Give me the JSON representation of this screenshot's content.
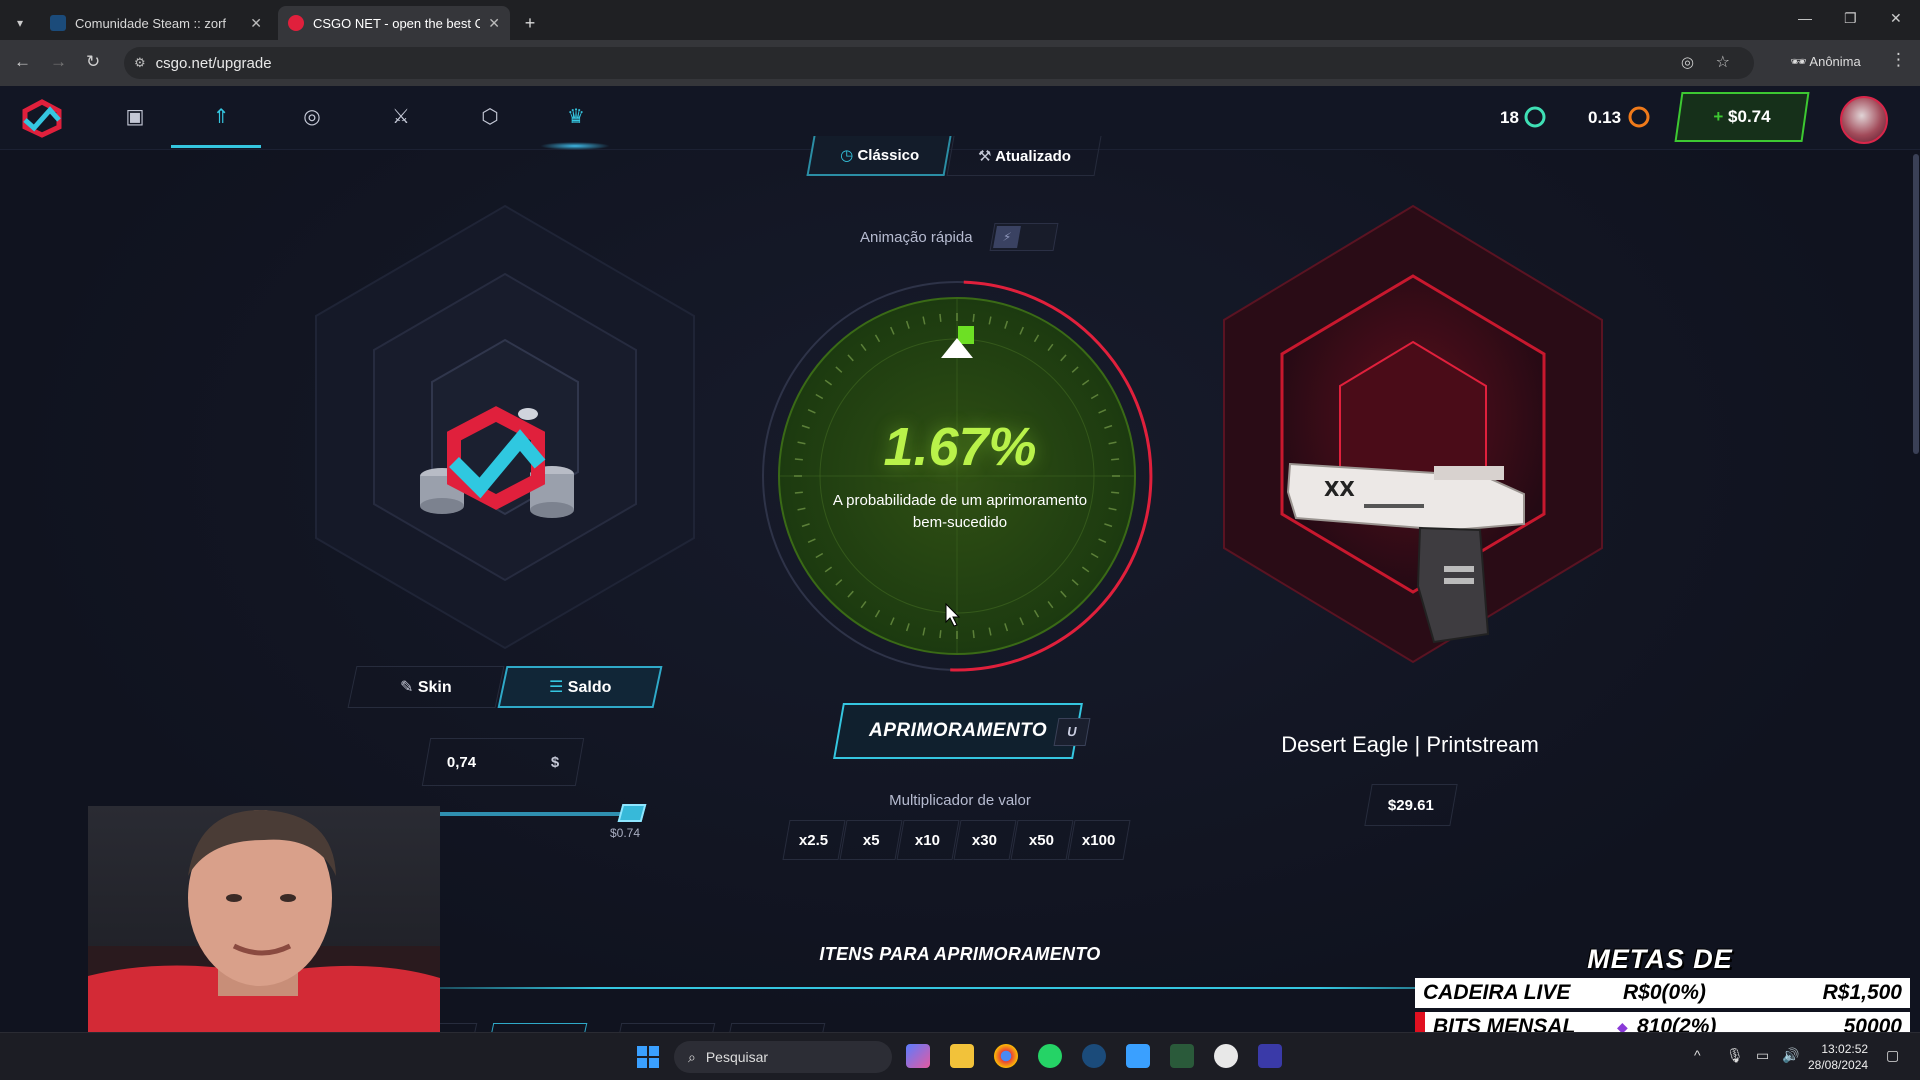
{
  "browser": {
    "tabs": [
      {
        "title": "Comunidade Steam :: zorf",
        "active": false
      },
      {
        "title": "CSGO NET - open the best CS",
        "active": true
      }
    ],
    "url": "csgo.net/upgrade",
    "profile_label": "Anônima"
  },
  "header": {
    "nav_icons": [
      "box-icon",
      "upgrade-icon",
      "target-icon",
      "crossed-swords-icon",
      "shield-icon",
      "crown-icon"
    ],
    "coins": "18",
    "points": "0.13",
    "deposit": "$0.74"
  },
  "mode": {
    "classic": "Clássico",
    "updated": "Atualizado"
  },
  "fast_animation_label": "Animação rápida",
  "left_panel": {
    "skin_tab": "Skin",
    "balance_tab": "Saldo",
    "amount": "0,74",
    "currency": "$",
    "slider_min": "$0",
    "slider_max": "$0.74",
    "slider_fraction": 1.0
  },
  "center": {
    "probability": "1.67%",
    "probability_value": 1.67,
    "description": "A probabilidade de um aprimoramento bem-sucedido",
    "upgrade_button": "APRIMORAMENTO",
    "hotkey": "U",
    "multiplier_label": "Multiplicador de valor",
    "multipliers": [
      "x2.5",
      "x5",
      "x10",
      "x30",
      "x50",
      "x100"
    ]
  },
  "right_panel": {
    "item_name": "Desert Eagle | Printstream",
    "price": "$29.61"
  },
  "items_title": "ITENS PARA APRIMORAMENTO",
  "goals": {
    "title": "METAS DE AGOSTO",
    "rows": [
      {
        "name": "CADEIRA LIVE",
        "progress": "R$0(0%)",
        "target": "R$1,500"
      },
      {
        "name": "BITS MENSAL",
        "progress": "810(2%)",
        "target": "50000"
      }
    ]
  },
  "taskbar": {
    "search_placeholder": "Pesquisar",
    "time": "13:02:52",
    "date": "28/08/2024"
  },
  "colors": {
    "accent": "#35c6e0",
    "success": "#3dc832",
    "danger": "#e0203c",
    "chance": "#b9f24a"
  }
}
